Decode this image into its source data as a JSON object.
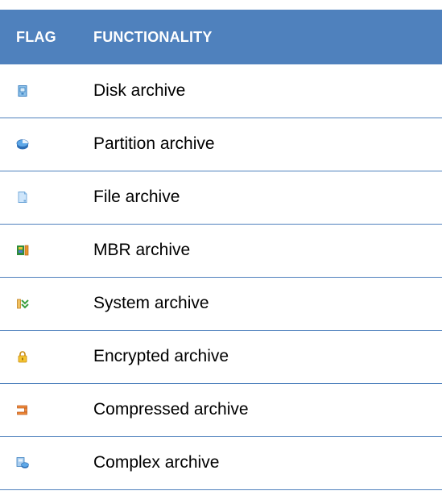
{
  "table": {
    "headers": {
      "flag": "FLAG",
      "functionality": "FUNCTIONALITY"
    },
    "rows": [
      {
        "icon": "disk-icon",
        "label": "Disk archive"
      },
      {
        "icon": "partition-icon",
        "label": "Partition archive"
      },
      {
        "icon": "file-icon",
        "label": "File archive"
      },
      {
        "icon": "mbr-icon",
        "label": "MBR archive"
      },
      {
        "icon": "system-icon",
        "label": "System archive"
      },
      {
        "icon": "lock-icon",
        "label": "Encrypted archive"
      },
      {
        "icon": "compressed-icon",
        "label": "Compressed archive"
      },
      {
        "icon": "complex-icon",
        "label": "Complex archive"
      }
    ]
  },
  "colors": {
    "header_bg": "#4f81bd",
    "header_text": "#ffffff",
    "row_border": "#4f81bd"
  }
}
